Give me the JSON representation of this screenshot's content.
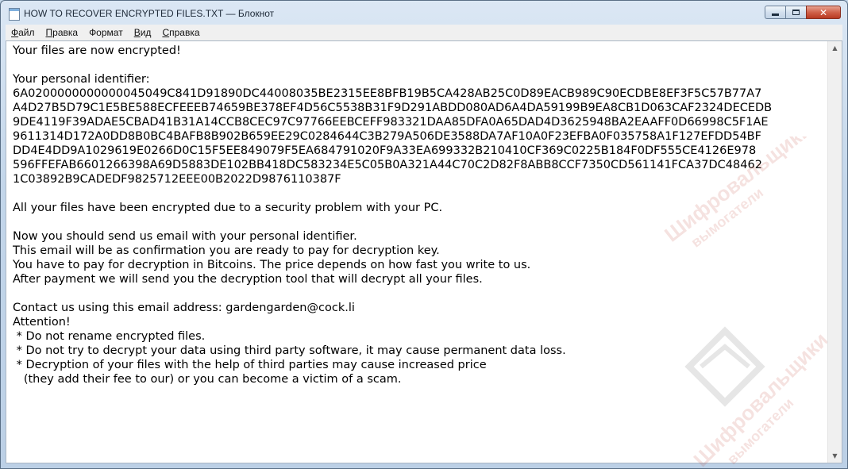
{
  "window": {
    "title": "HOW TO RECOVER ENCRYPTED FILES.TXT — Блокнот",
    "buttons": {
      "minimize": "minimize",
      "maximize": "maximize",
      "close": "✕"
    }
  },
  "menu": [
    {
      "underline": "Ф",
      "rest": "айл"
    },
    {
      "underline": "П",
      "rest": "равка"
    },
    {
      "underline": "",
      "rest": "Формат"
    },
    {
      "underline": "В",
      "rest": "ид"
    },
    {
      "underline": "С",
      "rest": "правка"
    }
  ],
  "menu_labels": [
    "Файл",
    "Правка",
    "Формат",
    "Вид",
    "Справка"
  ],
  "document": {
    "lines": [
      "Your files are now encrypted!",
      "",
      "Your personal identifier:",
      "6A0200000000000045049C841D91890DC44008035BE2315EE8BFB19B5CA428AB25C0D89EACB989C90ECDBE8EF3F5C57B77A7",
      "A4D27B5D79C1E5BE588ECFEEEB74659BE378EF4D56C5538B31F9D291ABDD080AD6A4DA59199B9EA8CB1D063CAF2324DECEDB",
      "9DE4119F39ADAE5CBAD41B31A14CCB8CEC97C97766EEBCEFF983321DAA85DFA0A65DAD4D3625948BA2EAAFF0D66998C5F1AE",
      "9611314D172A0DD8B0BC4BAFB8B902B659EE29C0284644C3B279A506DE3588DA7AF10A0F23EFBA0F035758A1F127EFDD54BF",
      "DD4E4DD9A1029619E0266D0C15F5EE849079F5EA684791020F9A33EA699332B210410CF369C0225B184F0DF555CE4126E978",
      "596FFEFAB6601266398A69D5883DE102BB418DC583234E5C05B0A321A44C70C2D82F8ABB8CCF7350CD561141FCA37DC48462",
      "1C03892B9CADEDF9825712EEE00B2022D9876110387F",
      "",
      "All your files have been encrypted due to a security problem with your PC.",
      "",
      "Now you should send us email with your personal identifier.",
      "This email will be as confirmation you are ready to pay for decryption key.",
      "You have to pay for decryption in Bitcoins. The price depends on how fast you write to us.",
      "After payment we will send you the decryption tool that will decrypt all your files.",
      "",
      "Contact us using this email address: gardengarden@cock.li",
      "Attention!",
      " * Do not rename encrypted files.",
      " * Do not try to decrypt your data using third party software, it may cause permanent data loss.",
      " * Decryption of your files with the help of third parties may cause increased price",
      "   (they add their fee to our) or you can become a victim of a scam."
    ]
  },
  "watermark": {
    "line1": "Шифровальщики",
    "line2": "вымогатели",
    "color": "#c0392b"
  },
  "scrollbar": {
    "up": "▲",
    "down": "▼"
  }
}
